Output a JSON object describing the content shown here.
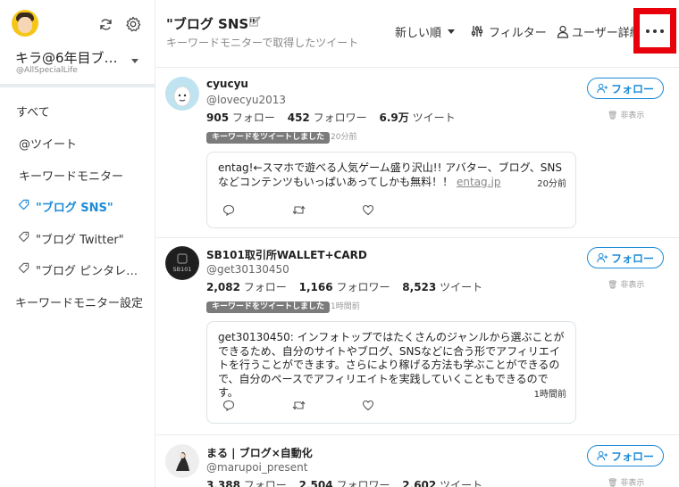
{
  "account": {
    "name": "キラ@6年目ブ…",
    "handle": "@AllSpecialLife"
  },
  "nav": [
    {
      "label": "すべて"
    },
    {
      "label": "@ツイート"
    },
    {
      "label": "キーワードモニター"
    },
    {
      "label": "\"ブログ SNS\"",
      "active": true
    },
    {
      "label": "\"ブログ Twitter\""
    },
    {
      "label": "\"ブログ ピンタレ…"
    },
    {
      "label": "キーワードモニター設定"
    }
  ],
  "header": {
    "title": "\"ブログ SNS\"",
    "subtitle": "キーワードモニターで取得したツイート",
    "sort_label": "新しい順",
    "filter_label": "フィルター",
    "user_detail_label": "ユーザー詳細"
  },
  "tweets": [
    {
      "name": "cyucyu",
      "handle": "@lovecyu2013",
      "follow_count": "905",
      "follow_label": "フォロー",
      "follower_count": "452",
      "follower_label": "フォロワー",
      "tweet_count": "6.9万",
      "tweet_label": "ツイート",
      "badge": "キーワードをツイートしました",
      "badge_time": "20分前",
      "follow_button": "フォロー",
      "hide_label": "非表示",
      "quote_text": "entag!←スマホで遊べる人気ゲーム盛り沢山!! アバター、ブログ、SNSなどコンテンツもいっぱいあってしかも無料！！",
      "quote_link": "entag.jp",
      "quote_time": "20分前"
    },
    {
      "name": "SB101取引所WALLET+CARD",
      "handle": "@get30130450",
      "follow_count": "2,082",
      "follow_label": "フォロー",
      "follower_count": "1,166",
      "follower_label": "フォロワー",
      "tweet_count": "8,523",
      "tweet_label": "ツイート",
      "badge": "キーワードをツイートしました",
      "badge_time": "1時間前",
      "follow_button": "フォロー",
      "hide_label": "非表示",
      "quote_text": "get30130450: インフォトップではたくさんのジャンルから選ぶことができるため、自分のサイトやブログ、SNSなどに合う形でアフィリエイトを行うことができます。さらにより稼げる方法も学ぶことができるので、自分のペースでアフィリエイトを実践していくこともできるのです。",
      "quote_time": "1時間前"
    },
    {
      "name": "まる | ブログ×自動化",
      "handle": "@marupoi_present",
      "follow_count": "3,388",
      "follow_label": "フォロー",
      "follower_count": "2,504",
      "follower_label": "フォロワー",
      "tweet_count": "2,602",
      "tweet_label": "ツイート",
      "follow_button": "フォロー",
      "hide_label": "非表示"
    }
  ],
  "colors": {
    "accent": "#1d8bd6",
    "highlight": "#e8000b",
    "badge": "#7b7b7b"
  }
}
